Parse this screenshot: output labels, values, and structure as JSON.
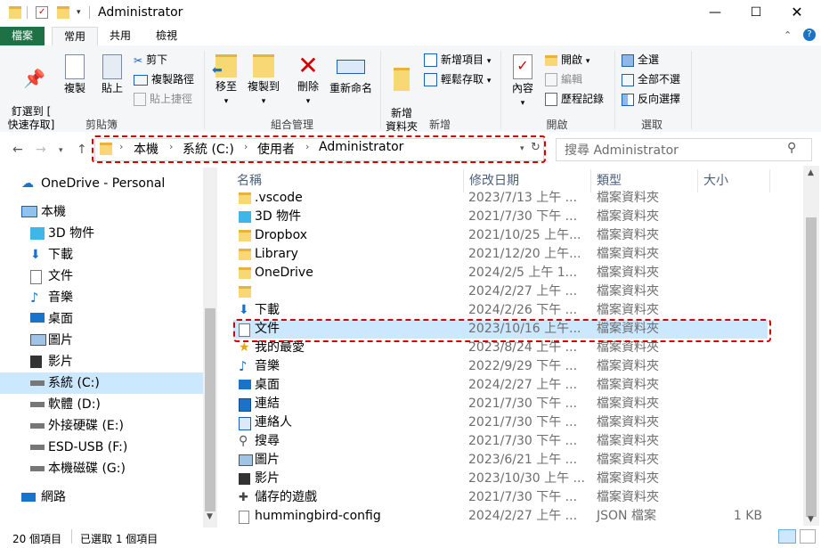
{
  "window": {
    "title": "Administrator"
  },
  "ribbon_tabs": [
    "檔案",
    "常用",
    "共用",
    "檢視"
  ],
  "ribbon": {
    "clipboard": {
      "pin": "釘選到 [\n快速存取]",
      "copy": "複製",
      "paste": "貼上",
      "cut": "剪下",
      "copy_path": "複製路徑",
      "paste_shortcut": "貼上捷徑",
      "label": "剪貼簿"
    },
    "organize": {
      "move_to": "移至",
      "copy_to": "複製到",
      "delete": "刪除",
      "rename": "重新命名",
      "label": "組合管理"
    },
    "new": {
      "new_folder": "新增\n資料夾",
      "new_item": "新增項目",
      "easy_access": "輕鬆存取",
      "label": "新增"
    },
    "open": {
      "properties": "內容",
      "open": "開啟",
      "edit": "編輯",
      "history": "歷程記錄",
      "label": "開啟"
    },
    "select": {
      "select_all": "全選",
      "select_none": "全部不選",
      "invert": "反向選擇",
      "label": "選取"
    }
  },
  "address": {
    "crumbs": [
      "本機",
      "系統 (C:)",
      "使用者",
      "Administrator"
    ]
  },
  "search": {
    "placeholder": "搜尋 Administrator"
  },
  "nav_pane": [
    {
      "label": "OneDrive - Personal",
      "icon": "cloud-icon"
    },
    {
      "label": "本機",
      "icon": "computer-icon"
    },
    {
      "label": "3D 物件",
      "icon": "cube-icon"
    },
    {
      "label": "下載",
      "icon": "download-icon"
    },
    {
      "label": "文件",
      "icon": "document-icon"
    },
    {
      "label": "音樂",
      "icon": "music-icon"
    },
    {
      "label": "桌面",
      "icon": "desktop-icon"
    },
    {
      "label": "圖片",
      "icon": "picture-icon"
    },
    {
      "label": "影片",
      "icon": "video-icon"
    },
    {
      "label": "系統 (C:)",
      "icon": "drive-icon"
    },
    {
      "label": "軟體 (D:)",
      "icon": "drive-icon"
    },
    {
      "label": "外接硬碟 (E:)",
      "icon": "drive-icon"
    },
    {
      "label": "ESD-USB (F:)",
      "icon": "drive-icon"
    },
    {
      "label": "本機磁碟 (G:)",
      "icon": "drive-icon"
    },
    {
      "label": "網路",
      "icon": "network-icon"
    }
  ],
  "columns": {
    "name": "名稱",
    "date": "修改日期",
    "type": "類型",
    "size": "大小"
  },
  "files": [
    {
      "name": ".vscode",
      "date": "2023/7/13 上午 ...",
      "type": "檔案資料夾",
      "size": ""
    },
    {
      "name": "3D 物件",
      "date": "2021/7/30 下午 ...",
      "type": "檔案資料夾",
      "size": ""
    },
    {
      "name": "Dropbox",
      "date": "2021/10/25 上午...",
      "type": "檔案資料夾",
      "size": ""
    },
    {
      "name": "Library",
      "date": "2021/12/20 上午...",
      "type": "檔案資料夾",
      "size": ""
    },
    {
      "name": "OneDrive",
      "date": "2024/2/5 上午 1...",
      "type": "檔案資料夾",
      "size": ""
    },
    {
      "name": "",
      "date": "2024/2/27 上午 ...",
      "type": "檔案資料夾",
      "size": ""
    },
    {
      "name": "下載",
      "date": "2024/2/26 下午 ...",
      "type": "檔案資料夾",
      "size": ""
    },
    {
      "name": "文件",
      "date": "2023/10/16 上午...",
      "type": "檔案資料夾",
      "size": ""
    },
    {
      "name": "我的最愛",
      "date": "2023/8/24 上午 ...",
      "type": "檔案資料夾",
      "size": ""
    },
    {
      "name": "音樂",
      "date": "2022/9/29 下午 ...",
      "type": "檔案資料夾",
      "size": ""
    },
    {
      "name": "桌面",
      "date": "2024/2/27 上午 ...",
      "type": "檔案資料夾",
      "size": ""
    },
    {
      "name": "連結",
      "date": "2021/7/30 下午 ...",
      "type": "檔案資料夾",
      "size": ""
    },
    {
      "name": "連絡人",
      "date": "2021/7/30 下午 ...",
      "type": "檔案資料夾",
      "size": ""
    },
    {
      "name": "搜尋",
      "date": "2021/7/30 下午 ...",
      "type": "檔案資料夾",
      "size": ""
    },
    {
      "name": "圖片",
      "date": "2023/6/21 上午 ...",
      "type": "檔案資料夾",
      "size": ""
    },
    {
      "name": "影片",
      "date": "2023/10/30 上午 ...",
      "type": "檔案資料夾",
      "size": ""
    },
    {
      "name": "儲存的遊戲",
      "date": "2021/7/30 下午 ...",
      "type": "檔案資料夾",
      "size": ""
    },
    {
      "name": "hummingbird-config",
      "date": "2024/2/27 上午 ...",
      "type": "JSON 檔案",
      "size": "1 KB"
    }
  ],
  "status": {
    "count": "20 個項目",
    "selected": "已選取 1 個項目"
  },
  "colors": {
    "accent": "#1e7145",
    "selection": "#cce8ff",
    "highlight": "#d40000",
    "folder": "#f8d775"
  }
}
